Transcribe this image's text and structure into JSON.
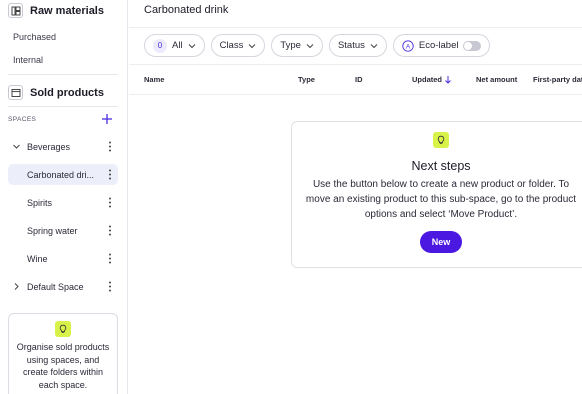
{
  "sidebar": {
    "raw_materials": {
      "title": "Raw materials",
      "icon": "raw-materials-icon",
      "links": [
        "Purchased",
        "Internal"
      ]
    },
    "sold_products": {
      "title": "Sold products",
      "icon": "window-icon"
    },
    "spaces_label": "SPACES",
    "tree": [
      {
        "label": "Beverages",
        "expanded": true
      },
      {
        "label": "Carbonated dri...",
        "selected": true
      },
      {
        "label": "Spirits"
      },
      {
        "label": "Spring water"
      },
      {
        "label": "Wine"
      },
      {
        "label": "Default Space",
        "expanded": false
      }
    ],
    "tip": "Organise sold products using spaces, and create folders within each space."
  },
  "main": {
    "title": "Carbonated drink",
    "filters": {
      "count": "0",
      "all": "All",
      "class": "Class",
      "type": "Type",
      "status": "Status",
      "eco_label": "Eco-label"
    },
    "columns": [
      "Name",
      "Type",
      "ID",
      "Updated",
      "Net amount",
      "First-party data"
    ],
    "empty_state": {
      "title": "Next steps",
      "body": "Use the button below to create a new product or folder. To move an existing product to this sub-space, go to the product options and select ‘Move Product’.",
      "button": "New"
    }
  },
  "colors": {
    "accent": "#4a18e0",
    "tip_bulb": "#d9f24a",
    "selected_bg": "#eceffa"
  }
}
